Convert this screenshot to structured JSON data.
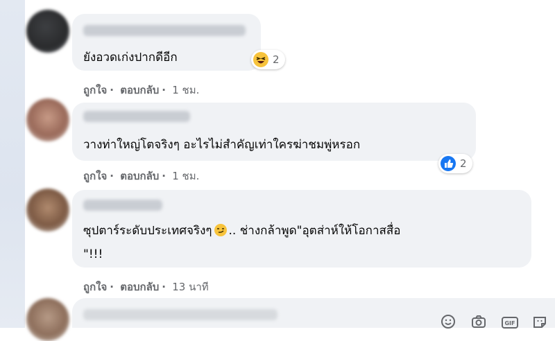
{
  "comments": [
    {
      "text": "ยังอวดเก่งปากดีอีก",
      "like": "ถูกใจ",
      "reply": "ตอบกลับ",
      "time": "1 ชม.",
      "reaction_count": "2",
      "reaction_icon": "laughing-emoji-icon"
    },
    {
      "text": "วางท่าใหญ่โตจริงๆ อะไรไม่สำคัญเท่าใครฆ่าชมพู่หรอก",
      "like": "ถูกใจ",
      "reply": "ตอบกลับ",
      "time": "1 ชม.",
      "reaction_count": "2",
      "reaction_icon": "like-thumb-icon"
    },
    {
      "text_line1_a": "ซุปตาร์ระดับประเทศจริงๆ",
      "text_line1_b": ".. ช่างกล้าพูด\"อุตส่าห์ให้โอกาสสื่อ",
      "text_line2": "\"!!!",
      "like": "ถูกใจ",
      "reply": "ตอบกลับ",
      "time": "13 นาที",
      "inline_emoji": "smirk-emoji-icon"
    }
  ],
  "composer_icons": [
    "emoji-icon",
    "camera-icon",
    "gif-icon",
    "sticker-icon"
  ],
  "colors": {
    "bubble": "#f0f2f5",
    "meta": "#65676b",
    "like_blue": "#1877f2",
    "emoji_yellow": "#f7c33c"
  }
}
